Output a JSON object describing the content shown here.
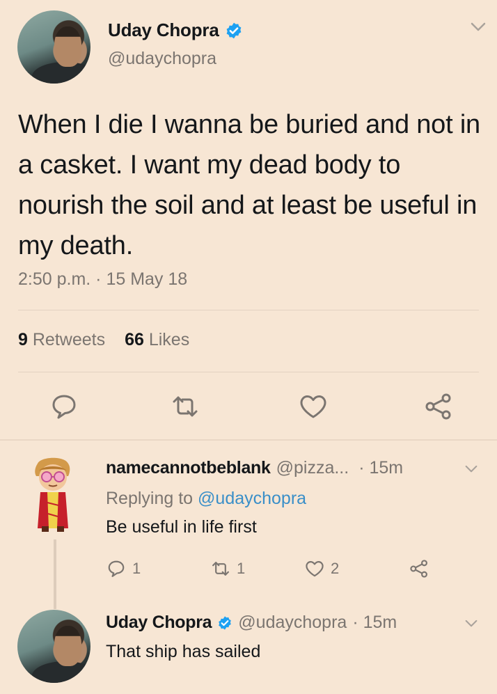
{
  "main_tweet": {
    "display_name": "Uday Chopra",
    "handle": "@udaychopra",
    "text": "When I die I wanna be buried and not in a casket. I want my dead body to nourish the soil and at least be useful in my death.",
    "timestamp": "2:50 p.m. · 15 May 18",
    "retweets_count": "9",
    "retweets_label": "Retweets",
    "likes_count": "66",
    "likes_label": "Likes"
  },
  "reply_1": {
    "display_name": "namecannotbeblank",
    "handle": "@pizza...",
    "time": "· 15m",
    "replying_prefix": "Replying to",
    "replying_to": "@udaychopra",
    "text": "Be useful in life first",
    "reply_count": "1",
    "retweet_count": "1",
    "like_count": "2"
  },
  "reply_2": {
    "display_name": "Uday Chopra",
    "handle": "@udaychopra",
    "time": "· 15m",
    "text": "That ship has sailed"
  },
  "colors": {
    "background": "#f7e6d4",
    "text": "#14171a",
    "muted": "#7b7570",
    "link": "#3a8fc8",
    "verified": "#1da1f2"
  },
  "icons": [
    "verified-badge-icon",
    "chevron-down-icon",
    "reply-icon",
    "retweet-icon",
    "like-icon",
    "share-icon"
  ]
}
